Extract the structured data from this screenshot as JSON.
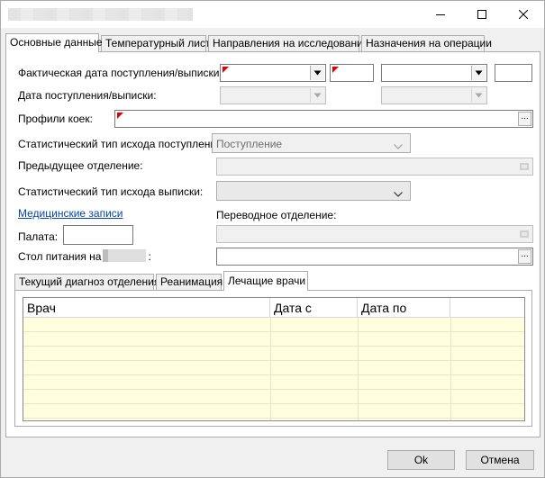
{
  "window": {
    "minimize_icon": "minimize-icon",
    "maximize_icon": "maximize-icon",
    "close_icon": "close-icon"
  },
  "tabs": [
    {
      "label": "Основные данные",
      "active": true
    },
    {
      "label": "Температурный лист",
      "active": false
    },
    {
      "label": "Направления на исследования",
      "active": false
    },
    {
      "label": "Назначения на операции",
      "active": false
    }
  ],
  "form": {
    "actual_date_label": "Фактическая дата поступления/выписки:",
    "admission_date_label": "Дата поступления/выписки:",
    "bed_profiles_label": "Профили коек:",
    "stat_type_admission_label": "Статистический тип исхода поступления:",
    "stat_type_admission_value": "Поступление",
    "prev_department_label": "Предыдущее отделение:",
    "stat_type_discharge_label": "Статистический тип исхода выписки:",
    "medical_records_link": "Медицинские записи",
    "transfer_department_label": "Переводное отделение:",
    "ward_label": "Палата:",
    "meal_table_label_prefix": "Стол питания на",
    "meal_table_label_suffix": ":"
  },
  "subtabs": [
    {
      "label": "Текущий диагноз отделения",
      "active": false
    },
    {
      "label": "Реанимация",
      "active": false
    },
    {
      "label": "Лечащие врачи",
      "active": true
    }
  ],
  "doctors_grid": {
    "columns": [
      "Врач",
      "Дата с",
      "Дата по",
      ""
    ],
    "rows": []
  },
  "buttons": {
    "ok": "Ok",
    "cancel": "Отмена"
  },
  "colors": {
    "required_marker": "#e00000",
    "grid_background": "#ffffe0",
    "link": "#0645ad"
  }
}
